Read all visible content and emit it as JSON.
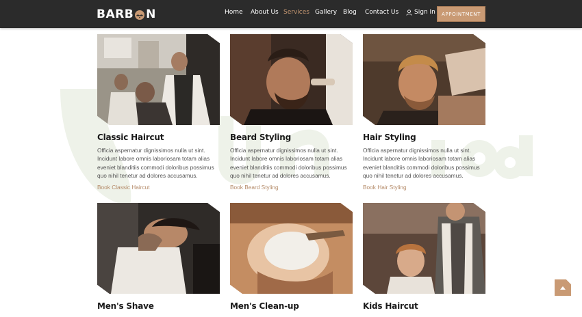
{
  "brand": {
    "name_left": "BARB",
    "name_right": "N",
    "accent_color": "#c99a74",
    "header_bg": "#2b2b2b"
  },
  "nav": {
    "items": [
      {
        "label": "Home",
        "active": false
      },
      {
        "label": "About Us",
        "active": false
      },
      {
        "label": "Services",
        "active": true
      },
      {
        "label": "Gallery",
        "active": false
      },
      {
        "label": "Blog",
        "active": false
      },
      {
        "label": "Contact Us",
        "active": false
      }
    ],
    "sign_in": "Sign In",
    "sign_in_icon": "user-icon",
    "appointment_label": "APPOINTMENT"
  },
  "services": [
    {
      "title": "Classic Haircut",
      "description": "Officia aspernatur dignissimos nulla ut sint. Incidunt labore omnis laboriosam totam alias eveniet blanditiis commodi doloribus possimus quo nihil tenetur ad dolores accusamus.",
      "link": "Book Classic Haircut"
    },
    {
      "title": "Beard Styling",
      "description": "Officia aspernatur dignissimos nulla ut sint. Incidunt labore omnis laboriosam totam alias eveniet blanditiis commodi doloribus possimus quo nihil tenetur ad dolores accusamus.",
      "link": "Book Beard Styling"
    },
    {
      "title": "Hair Styling",
      "description": "Officia aspernatur dignissimos nulla ut sint. Incidunt labore omnis laboriosam totam alias eveniet blanditiis commodi doloribus possimus quo nihil tenetur ad dolores accusamus.",
      "link": "Book Hair Styling"
    },
    {
      "title": "Men's Shave",
      "description": "",
      "link": ""
    },
    {
      "title": "Men's Clean-up",
      "description": "",
      "link": ""
    },
    {
      "title": "Kids Haircut",
      "description": "",
      "link": ""
    }
  ],
  "scroll_top_icon": "arrow-up-icon"
}
